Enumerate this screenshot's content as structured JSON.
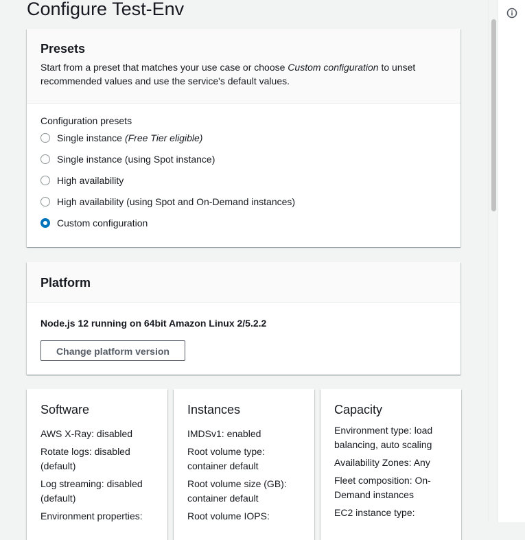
{
  "page": {
    "title": "Configure Test-Env"
  },
  "presets": {
    "title": "Presets",
    "description_pre": "Start from a preset that matches your use case or choose",
    "description_em": "Custom configuration",
    "description_post": "to unset recommended values and use the service's default values.",
    "group_label": "Configuration presets",
    "options": [
      {
        "label": "Single instance",
        "note": "(Free Tier eligible)",
        "checked": false
      },
      {
        "label": "Single instance (using Spot instance)",
        "checked": false
      },
      {
        "label": "High availability",
        "checked": false
      },
      {
        "label": "High availability (using Spot and On-Demand instances)",
        "checked": false
      },
      {
        "label": "Custom configuration",
        "checked": true
      }
    ]
  },
  "platform": {
    "title": "Platform",
    "name": "Node.js 12 running on 64bit Amazon Linux 2/5.2.2",
    "change_button": "Change platform version"
  },
  "software": {
    "title": "Software",
    "items": [
      "AWS X-Ray: disabled",
      "Rotate logs: disabled (default)",
      "Log streaming: disabled (default)",
      "Environment properties:"
    ]
  },
  "instances": {
    "title": "Instances",
    "items": [
      "IMDSv1: enabled",
      "Root volume type: container default",
      "Root volume size (GB): container default",
      "Root volume IOPS:"
    ]
  },
  "capacity": {
    "title": "Capacity",
    "items": [
      "Environment type: load balancing, auto scaling",
      "Availability Zones: Any",
      "Fleet composition: On-Demand instances",
      "EC2 instance type:"
    ]
  },
  "colors": {
    "accent": "#0073bb",
    "text": "#16191f",
    "background": "#f2f3f3"
  },
  "icons": {
    "rail": "info-icon"
  }
}
